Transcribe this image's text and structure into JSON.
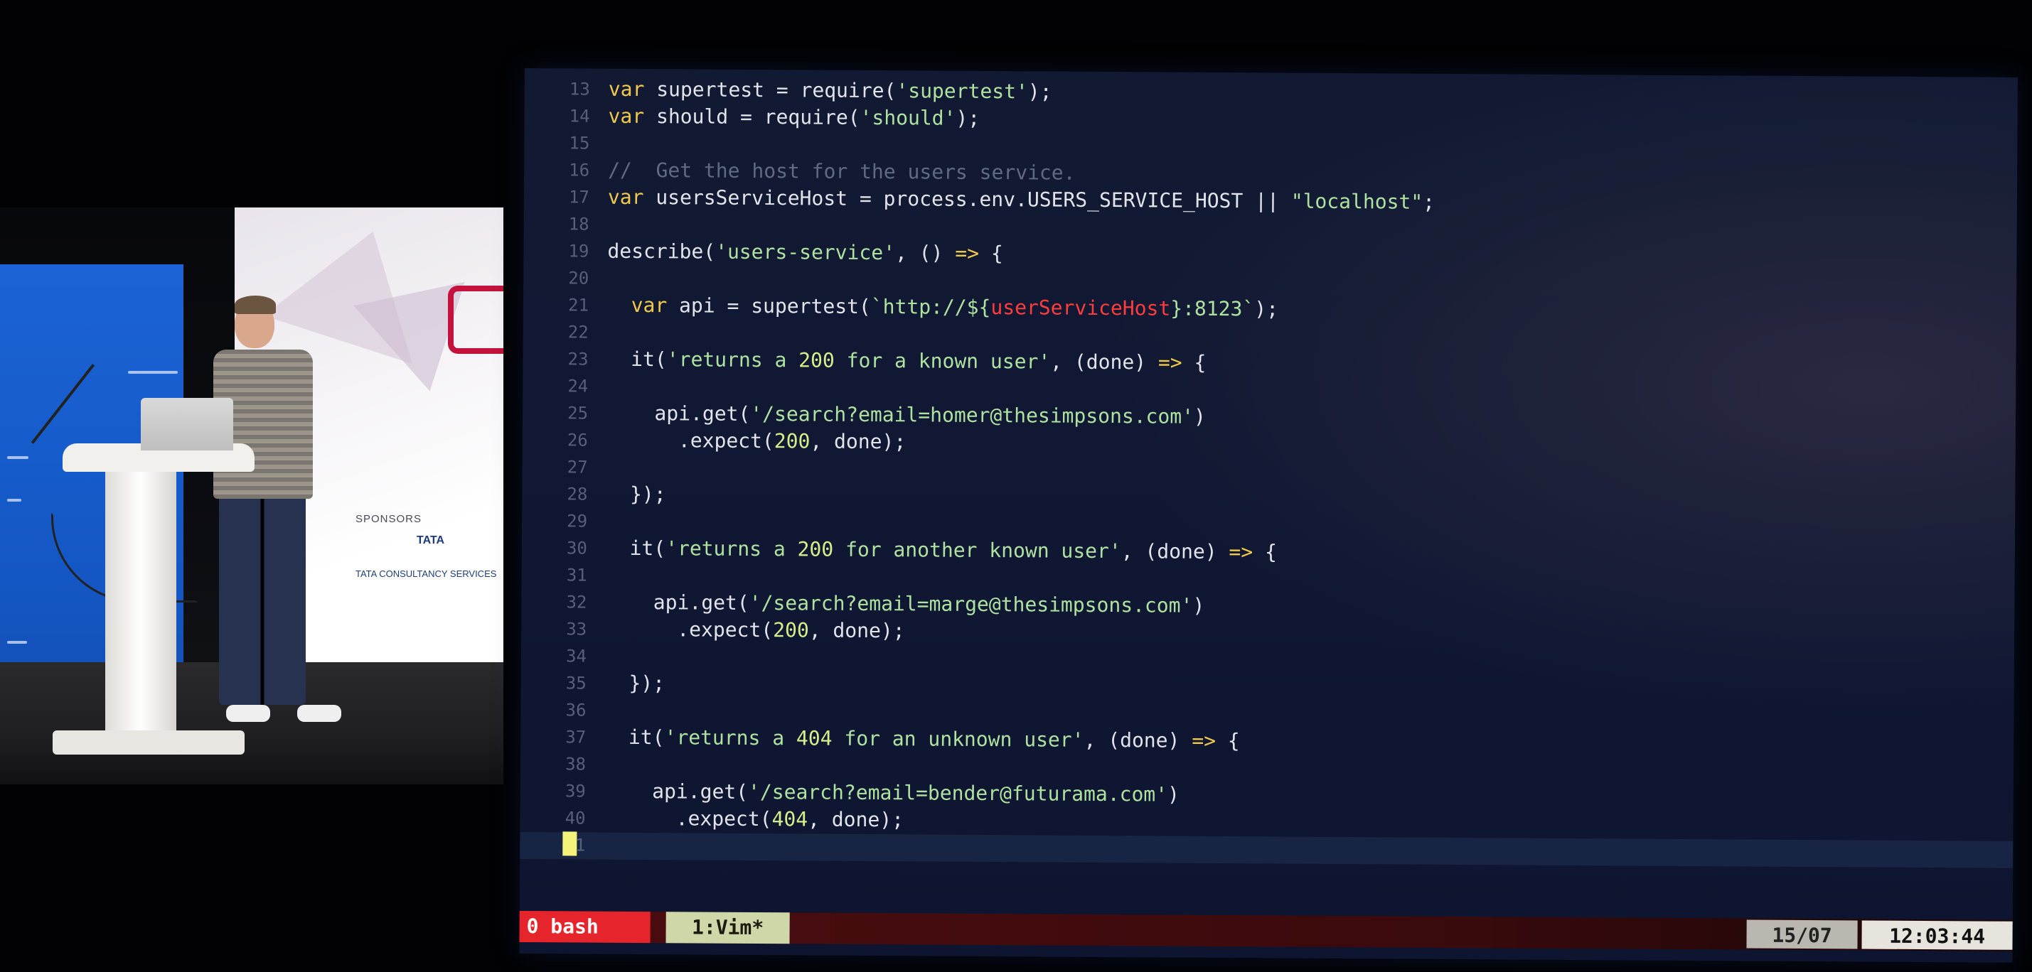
{
  "editor": {
    "lines": [
      {
        "n": "13",
        "parts": [
          [
            "kw",
            "var"
          ],
          [
            "plain",
            " supertest = require("
          ],
          [
            "str",
            "'supertest'"
          ],
          [
            "plain",
            ");"
          ]
        ]
      },
      {
        "n": "14",
        "parts": [
          [
            "kw",
            "var"
          ],
          [
            "plain",
            " should = require("
          ],
          [
            "str",
            "'should'"
          ],
          [
            "plain",
            ");"
          ]
        ]
      },
      {
        "n": "15",
        "parts": []
      },
      {
        "n": "16",
        "parts": [
          [
            "cmt",
            "//  Get the host for the users service."
          ]
        ]
      },
      {
        "n": "17",
        "parts": [
          [
            "kw",
            "var"
          ],
          [
            "plain",
            " usersServiceHost = process.env.USERS_SERVICE_HOST || "
          ],
          [
            "str",
            "\"localhost\""
          ],
          [
            "plain",
            ";"
          ]
        ]
      },
      {
        "n": "18",
        "parts": []
      },
      {
        "n": "19",
        "parts": [
          [
            "plain",
            "describe("
          ],
          [
            "str",
            "'users-service'"
          ],
          [
            "plain",
            ", () "
          ],
          [
            "arr",
            "=>"
          ],
          [
            "plain",
            " {"
          ]
        ]
      },
      {
        "n": "20",
        "parts": []
      },
      {
        "n": "21",
        "parts": [
          [
            "plain",
            "  "
          ],
          [
            "kw",
            "var"
          ],
          [
            "plain",
            " api = supertest("
          ],
          [
            "str",
            "`http://${"
          ],
          [
            "err",
            "userServiceHost"
          ],
          [
            "str",
            "}:8123`"
          ],
          [
            "plain",
            ");"
          ]
        ]
      },
      {
        "n": "22",
        "parts": []
      },
      {
        "n": "23",
        "parts": [
          [
            "plain",
            "  it("
          ],
          [
            "str",
            "'returns a "
          ],
          [
            "num",
            "200"
          ],
          [
            "str",
            " for a known user'"
          ],
          [
            "plain",
            ", (done) "
          ],
          [
            "arr",
            "=>"
          ],
          [
            "plain",
            " {"
          ]
        ]
      },
      {
        "n": "24",
        "parts": []
      },
      {
        "n": "25",
        "parts": [
          [
            "plain",
            "    api.get("
          ],
          [
            "str",
            "'/search?email=homer@thesimpsons.com'"
          ],
          [
            "plain",
            ")"
          ]
        ]
      },
      {
        "n": "26",
        "parts": [
          [
            "plain",
            "      .expect("
          ],
          [
            "num",
            "200"
          ],
          [
            "plain",
            ", done);"
          ]
        ]
      },
      {
        "n": "27",
        "parts": []
      },
      {
        "n": "28",
        "parts": [
          [
            "plain",
            "  });"
          ]
        ]
      },
      {
        "n": "29",
        "parts": []
      },
      {
        "n": "30",
        "parts": [
          [
            "plain",
            "  it("
          ],
          [
            "str",
            "'returns a "
          ],
          [
            "num",
            "200"
          ],
          [
            "str",
            " for another known user'"
          ],
          [
            "plain",
            ", (done) "
          ],
          [
            "arr",
            "=>"
          ],
          [
            "plain",
            " {"
          ]
        ]
      },
      {
        "n": "31",
        "parts": []
      },
      {
        "n": "32",
        "parts": [
          [
            "plain",
            "    api.get("
          ],
          [
            "str",
            "'/search?email=marge@thesimpsons.com'"
          ],
          [
            "plain",
            ")"
          ]
        ]
      },
      {
        "n": "33",
        "parts": [
          [
            "plain",
            "      .expect("
          ],
          [
            "num",
            "200"
          ],
          [
            "plain",
            ", done);"
          ]
        ]
      },
      {
        "n": "34",
        "parts": []
      },
      {
        "n": "35",
        "parts": [
          [
            "plain",
            "  });"
          ]
        ]
      },
      {
        "n": "36",
        "parts": []
      },
      {
        "n": "37",
        "parts": [
          [
            "plain",
            "  it("
          ],
          [
            "str",
            "'returns a "
          ],
          [
            "num",
            "404"
          ],
          [
            "str",
            " for an unknown user'"
          ],
          [
            "plain",
            ", (done) "
          ],
          [
            "arr",
            "=>"
          ],
          [
            "plain",
            " {"
          ]
        ]
      },
      {
        "n": "38",
        "parts": []
      },
      {
        "n": "39",
        "parts": [
          [
            "plain",
            "    api.get("
          ],
          [
            "str",
            "'/search?email=bender@futurama.com'"
          ],
          [
            "plain",
            ")"
          ]
        ]
      },
      {
        "n": "40",
        "parts": [
          [
            "plain",
            "      .expect("
          ],
          [
            "num",
            "404"
          ],
          [
            "plain",
            ", done);"
          ]
        ]
      },
      {
        "n": "41",
        "parts": []
      }
    ]
  },
  "tmux": {
    "window_1": "0 bash",
    "window_2": "1:Vim*",
    "date": "15/07",
    "time": "12:03:44"
  },
  "stage": {
    "sponsors_label": "SPONSORS",
    "sponsor_mark": "TATA",
    "sponsor_name": "TATA CONSULTANCY SERVICES"
  },
  "colors": {
    "terminal_bg": "#121a33",
    "keyword": "#f0c94a",
    "string": "#aee2a0",
    "comment": "#5e6b83",
    "error_highlight": "#ff3d3d",
    "tmux_active_tab": "#e5242c",
    "tmux_vim_tab": "#cfd6a8"
  }
}
